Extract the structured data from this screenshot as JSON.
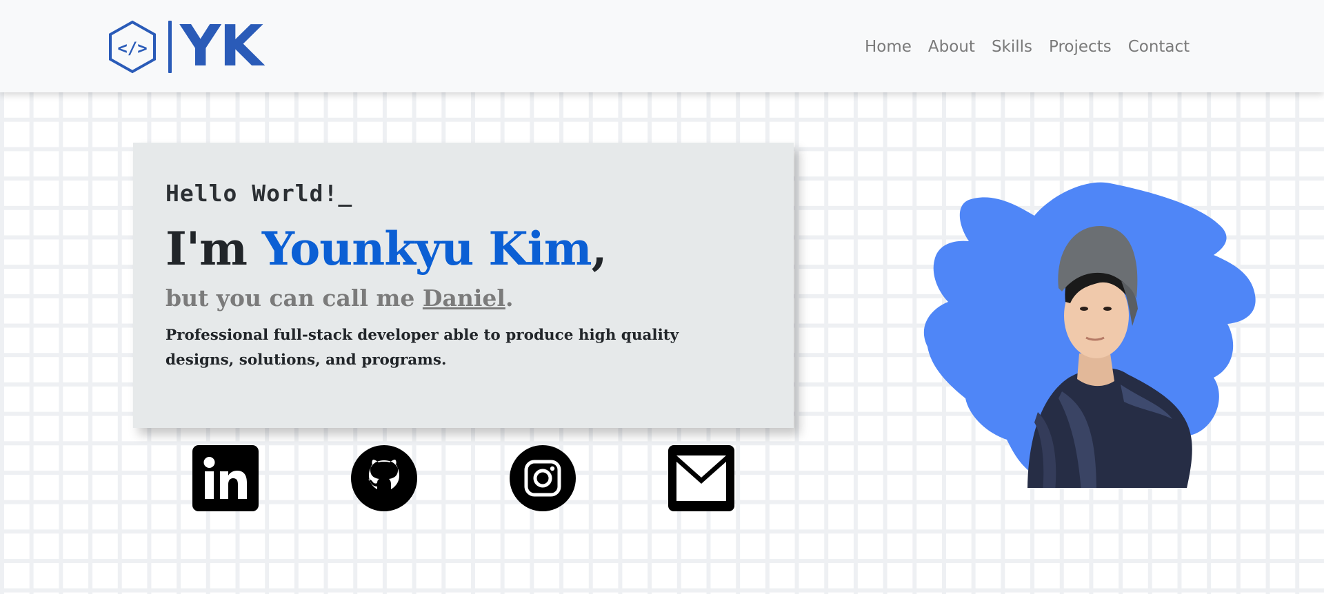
{
  "brand": {
    "logo_icon": "code-hexagon-icon",
    "text": "YK",
    "color": "#2a5bb8"
  },
  "nav": {
    "items": [
      {
        "label": "Home"
      },
      {
        "label": "About"
      },
      {
        "label": "Skills"
      },
      {
        "label": "Projects"
      },
      {
        "label": "Contact"
      }
    ]
  },
  "hero": {
    "greeting": "Hello World!_",
    "intro_prefix": "I'm ",
    "name": "Younkyu Kim",
    "intro_suffix": ",",
    "sub_prefix": "but you can call me ",
    "nickname": "Daniel",
    "sub_suffix": ".",
    "description": "Professional full-stack developer able to produce high quality designs, solutions, and programs.",
    "name_color": "#0b5fd4"
  },
  "social": [
    {
      "name": "linkedin",
      "icon": "linkedin-icon"
    },
    {
      "name": "github",
      "icon": "github-icon"
    },
    {
      "name": "instagram",
      "icon": "instagram-icon"
    },
    {
      "name": "email",
      "icon": "mail-icon"
    }
  ],
  "portrait": {
    "backdrop_color": "#4f86f7",
    "icon": "portrait-photo"
  }
}
